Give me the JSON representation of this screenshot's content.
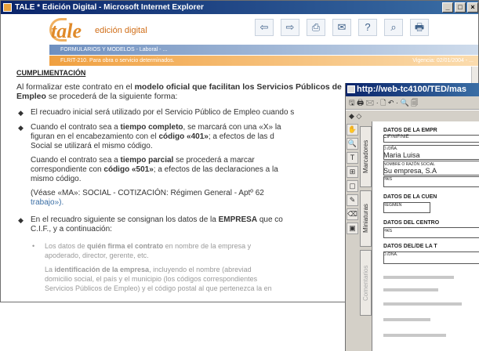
{
  "window1": {
    "title": "TALE * Edición Digital - Microsoft Internet Explorer",
    "buttons": [
      "_",
      "□",
      "×"
    ]
  },
  "header": {
    "logo_text": "tale",
    "logo_sub": "edición digital",
    "nav_icons": [
      "back-icon",
      "forward-icon",
      "print-icon",
      "mail-icon",
      "help-icon",
      "search-icon",
      "printer-icon"
    ],
    "nav_glyphs": [
      "⇦",
      "⇨",
      "⎙",
      "✉",
      "?",
      "⌕",
      "🖶"
    ]
  },
  "bars": {
    "blue_label": "FORMULARIOS Y MODELOS - Laboral - ...",
    "orange_label": "FLRIT-210. Para obra o servicio determinados.",
    "vigencia": "Vigencia: 02/01/2004 - ..."
  },
  "content": {
    "heading": "CUMPLIMENTACIÓN",
    "p1_a": "Al formalizar este contrato en el ",
    "p1_bold": "modelo oficial que facilitan los Servicios Públicos de Empleo",
    "p1_b": " se procederá de la siguiente forma:",
    "b1": "El recuadro inicial será utilizado por el Servicio Público de Empleo cuando s",
    "b2_a": "Cuando el contrato sea a ",
    "b2_bold": "tiempo completo",
    "b2_b": ", se marcará con una «X» la",
    "b2_l2": "figuran en el encabezamiento con el ",
    "b2_code": "código «401»",
    "b2_l2b": "; a efectos de las d",
    "b2_l3": "Social se utilizará el mismo código.",
    "b3_a": "Cuando el contrato sea a ",
    "b3_bold": "tiempo parcial",
    "b3_b": " se procederá a marcar",
    "b3_l2": "correspondiente con ",
    "b3_code": "código «501»",
    "b3_l2b": "; a efectos de las declaraciones a la",
    "b3_l3": "mismo código.",
    "b4_a": "(Véase «MA»: SOCIAL - COTIZACIÓN: Régimen General - Aptº 62",
    "b4_link": "trabajo»).",
    "b5_a": "En el recuadro siguiente se consignan los datos de la ",
    "b5_bold": "EMPRESA",
    "b5_b": " que co",
    "b5_l2": "C.I.F., y a continuación:",
    "s1_a": "Los datos de ",
    "s1_bold": "quién firma el contrato",
    "s1_b": " en nombre de la empresa y",
    "s1_l2": "apoderado, director, gerente, etc.",
    "s2_a": "La ",
    "s2_bold": "identificación de la empresa",
    "s2_b": ", incluyendo el nombre (abreviad",
    "s2_l2": "domicilio social, el país y el municipio (los códigos correspondientes",
    "s2_l3": "Servicios Públicos de Empleo) y el código postal al que pertenezca la en"
  },
  "window2": {
    "title": "http://web-tc4100/TED/mas",
    "toolbar": "🖫 🖨 🖂 · 🗋 ↶ · 🔍 🗐",
    "toolbar2": "◆ ◇",
    "tools": [
      "✋",
      "🔍",
      "T",
      "⊞",
      "▢",
      "✎",
      "⌫",
      "▣"
    ],
    "tab_marcadores": "Marcadores",
    "tab_miniaturas": "Miniaturas",
    "tab_comentarios": "Comentarios",
    "form": {
      "datos_empresa": "DATOS DE LA EMPR",
      "cif": "CIF/NIF/NIE",
      "dona": "D./DÑA.",
      "name": "Maria Luisa",
      "razon": "NOMBRE O RAZÓN SOCIAL",
      "company": "Su empresa, S.A",
      "pais": "PAÍS",
      "datos_cuenta": "DATOS DE LA CUEN",
      "regimen": "RÉGIMEN",
      "datos_centro": "DATOS DEL CENTRO",
      "pais2": "PAÍS",
      "datos_trab": "DATOS DEL/DE LA T",
      "dona2": "D./DÑA."
    }
  }
}
